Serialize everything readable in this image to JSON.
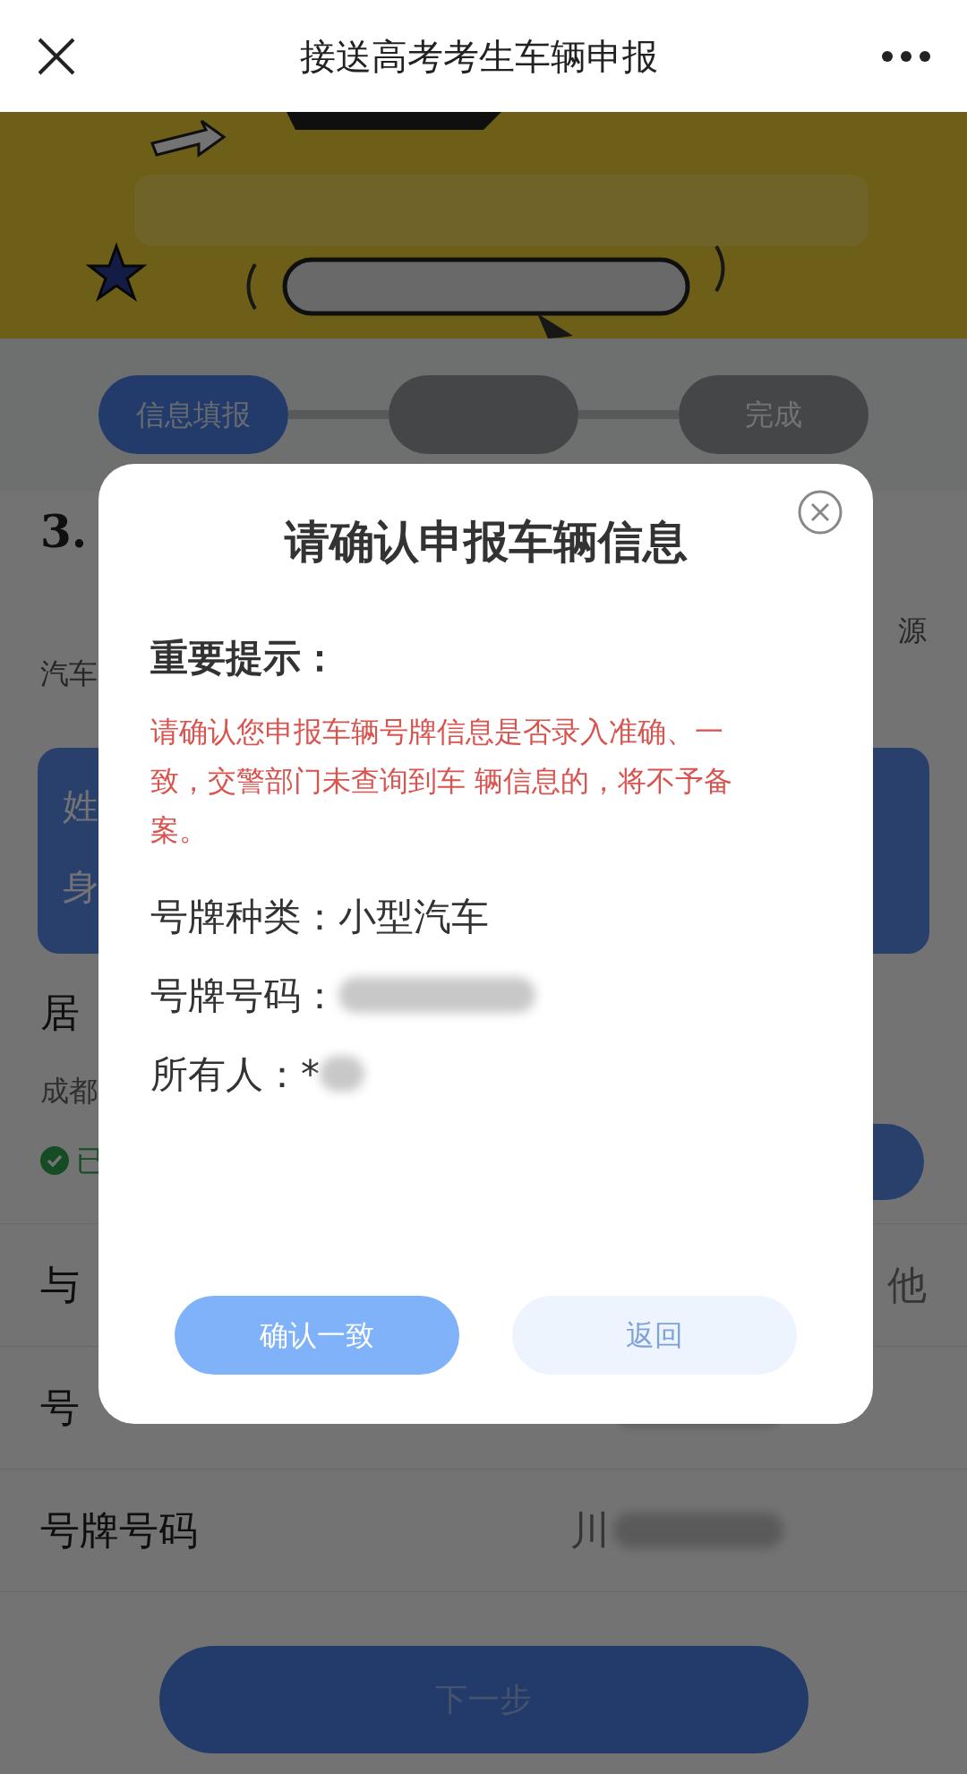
{
  "header": {
    "title": "接送高考考生车辆申报"
  },
  "steps": [
    {
      "label": "信息填报",
      "selected": true
    },
    {
      "selected": false
    },
    {
      "label": "完成",
      "selected": false
    }
  ],
  "page": {
    "heading": "3.",
    "note_right": "源",
    "note_left": "汽车",
    "card_lines": [
      "姓",
      "身"
    ],
    "residence_label": "居",
    "residence_value": "成都",
    "status": "已",
    "rows": [
      {
        "label": "与",
        "value": "他",
        "redacted": false
      },
      {
        "label": "号",
        "redacted": true
      },
      {
        "label": "号牌号码",
        "value": "川",
        "redacted": true
      }
    ]
  },
  "next_button": "下一步",
  "dialog": {
    "title": "请确认申报车辆信息",
    "notice_heading": "重要提示：",
    "notice": "请确认您申报车辆号牌信息是否录入准确、一致，交警部门未查询到车 辆信息的，将不予备案。",
    "fields": [
      {
        "label": "号牌种类：",
        "value": "小型汽车",
        "redacted": false
      },
      {
        "label": "号牌号码：",
        "redacted": true
      },
      {
        "label": "所有人：",
        "value": "*",
        "redacted": true
      }
    ],
    "buttons": [
      {
        "label": "确认一致",
        "kind": "primary"
      },
      {
        "label": "返回",
        "kind": "secondary"
      }
    ]
  }
}
